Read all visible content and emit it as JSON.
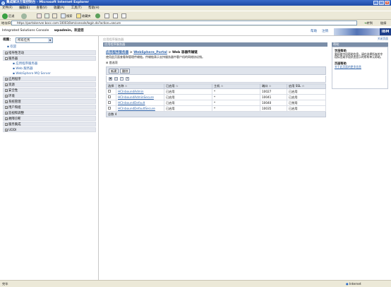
{
  "window": {
    "title": "集成解决方案控制台 - Microsoft Internet Explorer",
    "buttons": [
      "_",
      "□",
      "×"
    ]
  },
  "menu": [
    "文件(F)",
    "编辑(E)",
    "查看(V)",
    "收藏(A)",
    "工具(T)",
    "帮助(H)"
  ],
  "toolbar": {
    "back": "后退",
    "search": "搜索",
    "favorites": "收藏夹"
  },
  "address": {
    "label": "地址(D)",
    "url": "https://portalserver.bocc.com:10003/ibm/console/login.do?action=secure",
    "go": "转到",
    "links": "链接"
  },
  "banner": {
    "console": "Integrated Solutions Console",
    "user": "wpadmin，欢迎您",
    "help": "帮助",
    "logout": "注销",
    "ibm": "IBM"
  },
  "left": {
    "view_label": "视图：",
    "view_value": "所有任务",
    "welcome": "欢迎",
    "nav": [
      {
        "label": "指导性活动",
        "type": "row"
      },
      {
        "label": "服务器",
        "type": "row"
      },
      {
        "label": "应用程序服务器",
        "type": "sub"
      },
      {
        "label": "Web 服务器",
        "type": "sub"
      },
      {
        "label": "WebSphere MQ Server",
        "type": "sub"
      },
      {
        "label": "应用程序",
        "type": "row"
      },
      {
        "label": "资源",
        "type": "row"
      },
      {
        "label": "安全性",
        "type": "row"
      },
      {
        "label": "环境",
        "type": "row"
      },
      {
        "label": "系统管理",
        "type": "row"
      },
      {
        "label": "用户和组",
        "type": "row"
      },
      {
        "label": "监视和调整",
        "type": "row"
      },
      {
        "label": "故障诊断",
        "type": "row"
      },
      {
        "label": "服务集成",
        "type": "row"
      },
      {
        "label": "UDDI",
        "type": "row"
      }
    ]
  },
  "main": {
    "top_crumb": "应用程序服务器",
    "panel_title": "应用程序服务器",
    "crumb": {
      "c1": "应用程序服务器",
      "c2": "WebSphere_Portal",
      "c3": "Web 容器传输链"
    },
    "description": "使用此页面查看和管理传输链。传输链表示支持服务器中客户机的网络协议栈。",
    "preferences": "首选项",
    "new_btn": "新建",
    "delete_btn": "删除",
    "columns": [
      "选择",
      "名称 ☆",
      "已启用 ☆",
      "主机 ☆",
      "端口 ☆",
      "启用 SSL ☆"
    ],
    "rows": [
      {
        "name": "HCInboundAdmin",
        "enabled": "已启用",
        "host": "*",
        "port": "10027",
        "ssl": "已启用"
      },
      {
        "name": "HCInboundAdminSecure",
        "enabled": "已启用",
        "host": "*",
        "port": "10041",
        "ssl": "已启用"
      },
      {
        "name": "HCInboundDefault",
        "enabled": "已启用",
        "host": "*",
        "port": "10040",
        "ssl": "已禁用"
      },
      {
        "name": "HCInboundDefaultSecure",
        "enabled": "已启用",
        "host": "*",
        "port": "10035",
        "ssl": "已启用"
      }
    ],
    "total": "总数 4"
  },
  "right": {
    "panel_title": "帮助",
    "close": "关闭页面",
    "field_help_title": "字段帮助",
    "field_help_text": "要获取字段帮助信息，请在选择所有的字段标签或字段状态显示的所有单元帮助。",
    "page_help_title": "页面帮助",
    "page_help_link": "关于此页面的更多信息"
  },
  "status": {
    "left": "完毕",
    "zone": "Internet"
  }
}
